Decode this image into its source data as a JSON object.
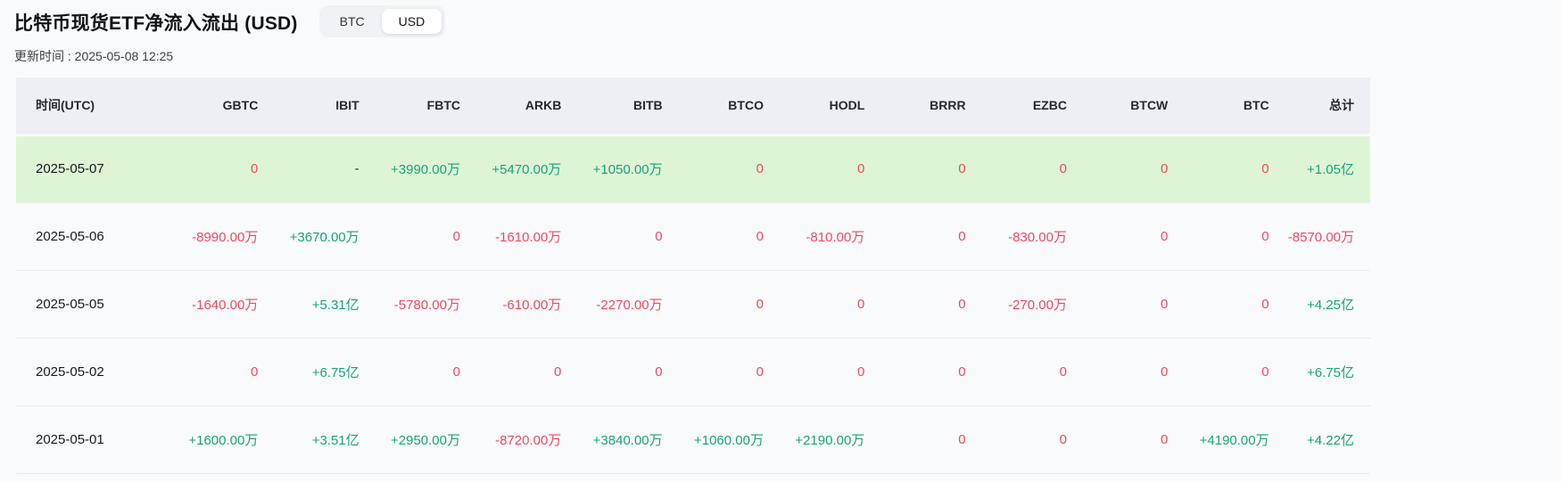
{
  "header": {
    "title": "比特币现货ETF净流入流出 (USD)",
    "updated_label": "更新时间 : 2025-05-08 12:25",
    "toggle": {
      "options": [
        "BTC",
        "USD"
      ],
      "selected": "USD"
    }
  },
  "colors": {
    "positive": "#17a37c",
    "negative": "#f4475d",
    "highlight_row_bg": "#ddf5d4",
    "header_bg": "#edeff4"
  },
  "table": {
    "columns": [
      "时间(UTC)",
      "GBTC",
      "IBIT",
      "FBTC",
      "ARKB",
      "BITB",
      "BTCO",
      "HODL",
      "BRRR",
      "EZBC",
      "BTCW",
      "BTC",
      "总计"
    ],
    "rows": [
      {
        "date": "2025-05-07",
        "highlighted": true,
        "cells": [
          {
            "v": "0",
            "c": "neg"
          },
          {
            "v": "-",
            "c": "neutral"
          },
          {
            "v": "+3990.00万",
            "c": "pos"
          },
          {
            "v": "+5470.00万",
            "c": "pos"
          },
          {
            "v": "+1050.00万",
            "c": "pos"
          },
          {
            "v": "0",
            "c": "neg"
          },
          {
            "v": "0",
            "c": "neg"
          },
          {
            "v": "0",
            "c": "neg"
          },
          {
            "v": "0",
            "c": "neg"
          },
          {
            "v": "0",
            "c": "neg"
          },
          {
            "v": "0",
            "c": "neg"
          },
          {
            "v": "+1.05亿",
            "c": "pos"
          }
        ]
      },
      {
        "date": "2025-05-06",
        "highlighted": false,
        "cells": [
          {
            "v": "-8990.00万",
            "c": "neg"
          },
          {
            "v": "+3670.00万",
            "c": "pos"
          },
          {
            "v": "0",
            "c": "neg"
          },
          {
            "v": "-1610.00万",
            "c": "neg"
          },
          {
            "v": "0",
            "c": "neg"
          },
          {
            "v": "0",
            "c": "neg"
          },
          {
            "v": "-810.00万",
            "c": "neg"
          },
          {
            "v": "0",
            "c": "neg"
          },
          {
            "v": "-830.00万",
            "c": "neg"
          },
          {
            "v": "0",
            "c": "neg"
          },
          {
            "v": "0",
            "c": "neg"
          },
          {
            "v": "-8570.00万",
            "c": "neg"
          }
        ]
      },
      {
        "date": "2025-05-05",
        "highlighted": false,
        "cells": [
          {
            "v": "-1640.00万",
            "c": "neg"
          },
          {
            "v": "+5.31亿",
            "c": "pos"
          },
          {
            "v": "-5780.00万",
            "c": "neg"
          },
          {
            "v": "-610.00万",
            "c": "neg"
          },
          {
            "v": "-2270.00万",
            "c": "neg"
          },
          {
            "v": "0",
            "c": "neg"
          },
          {
            "v": "0",
            "c": "neg"
          },
          {
            "v": "0",
            "c": "neg"
          },
          {
            "v": "-270.00万",
            "c": "neg"
          },
          {
            "v": "0",
            "c": "neg"
          },
          {
            "v": "0",
            "c": "neg"
          },
          {
            "v": "+4.25亿",
            "c": "pos"
          }
        ]
      },
      {
        "date": "2025-05-02",
        "highlighted": false,
        "cells": [
          {
            "v": "0",
            "c": "neg"
          },
          {
            "v": "+6.75亿",
            "c": "pos"
          },
          {
            "v": "0",
            "c": "neg"
          },
          {
            "v": "0",
            "c": "neg"
          },
          {
            "v": "0",
            "c": "neg"
          },
          {
            "v": "0",
            "c": "neg"
          },
          {
            "v": "0",
            "c": "neg"
          },
          {
            "v": "0",
            "c": "neg"
          },
          {
            "v": "0",
            "c": "neg"
          },
          {
            "v": "0",
            "c": "neg"
          },
          {
            "v": "0",
            "c": "neg"
          },
          {
            "v": "+6.75亿",
            "c": "pos"
          }
        ]
      },
      {
        "date": "2025-05-01",
        "highlighted": false,
        "cells": [
          {
            "v": "+1600.00万",
            "c": "pos"
          },
          {
            "v": "+3.51亿",
            "c": "pos"
          },
          {
            "v": "+2950.00万",
            "c": "pos"
          },
          {
            "v": "-8720.00万",
            "c": "neg"
          },
          {
            "v": "+3840.00万",
            "c": "pos"
          },
          {
            "v": "+1060.00万",
            "c": "pos"
          },
          {
            "v": "+2190.00万",
            "c": "pos"
          },
          {
            "v": "0",
            "c": "neg"
          },
          {
            "v": "0",
            "c": "neg"
          },
          {
            "v": "0",
            "c": "neg"
          },
          {
            "v": "+4190.00万",
            "c": "pos"
          },
          {
            "v": "+4.22亿",
            "c": "pos"
          }
        ]
      }
    ]
  }
}
